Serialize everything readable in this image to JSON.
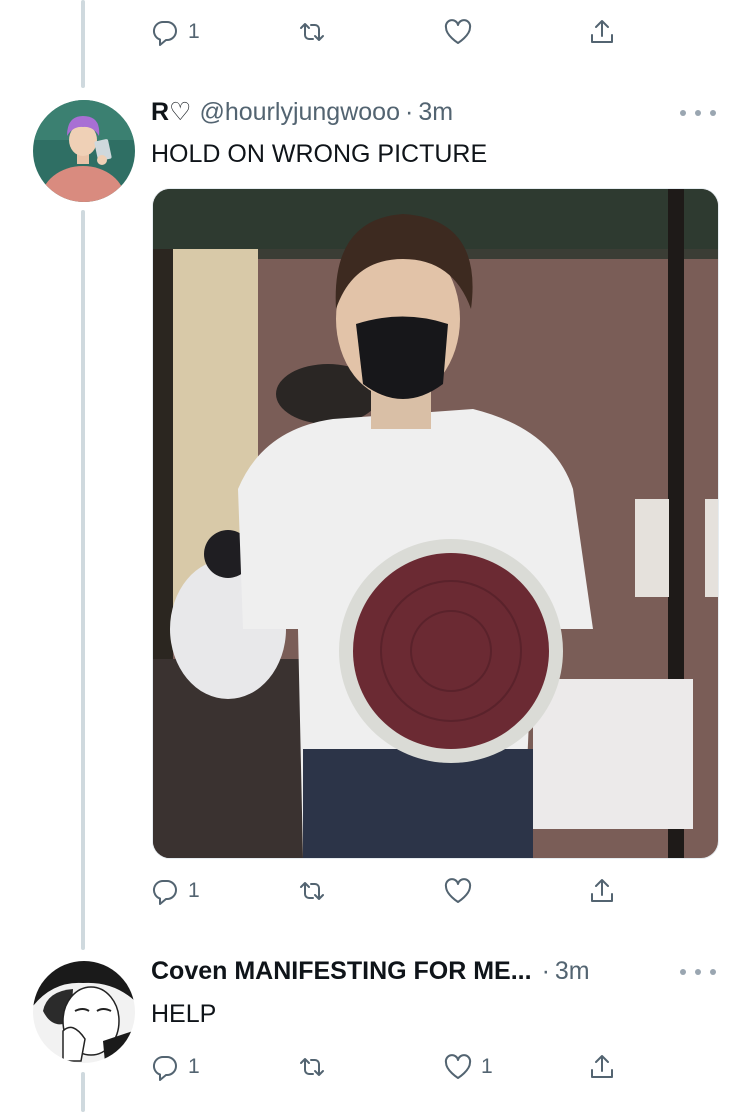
{
  "top_actions": {
    "reply_count": "1",
    "retweet_count": "",
    "like_count": ""
  },
  "tweet1": {
    "name": "R♡",
    "handle": "@hourlyjungwooo",
    "separator": "·",
    "time": "3m",
    "text": "HOLD ON WRONG PICTURE",
    "actions": {
      "reply_count": "1",
      "retweet_count": "",
      "like_count": ""
    }
  },
  "tweet2": {
    "name": "Coven MANIFESTING FOR ME...",
    "separator": "·",
    "time": "3m",
    "text": "HELP",
    "actions": {
      "reply_count": "1",
      "retweet_count": "",
      "like_count": "1"
    }
  },
  "icons": [
    "reply-icon",
    "retweet-icon",
    "like-icon",
    "share-icon",
    "more-icon"
  ],
  "colors": {
    "text": "#0f1419",
    "secondary": "#536471",
    "thread_line": "#cfd9de",
    "background": "#ffffff"
  }
}
